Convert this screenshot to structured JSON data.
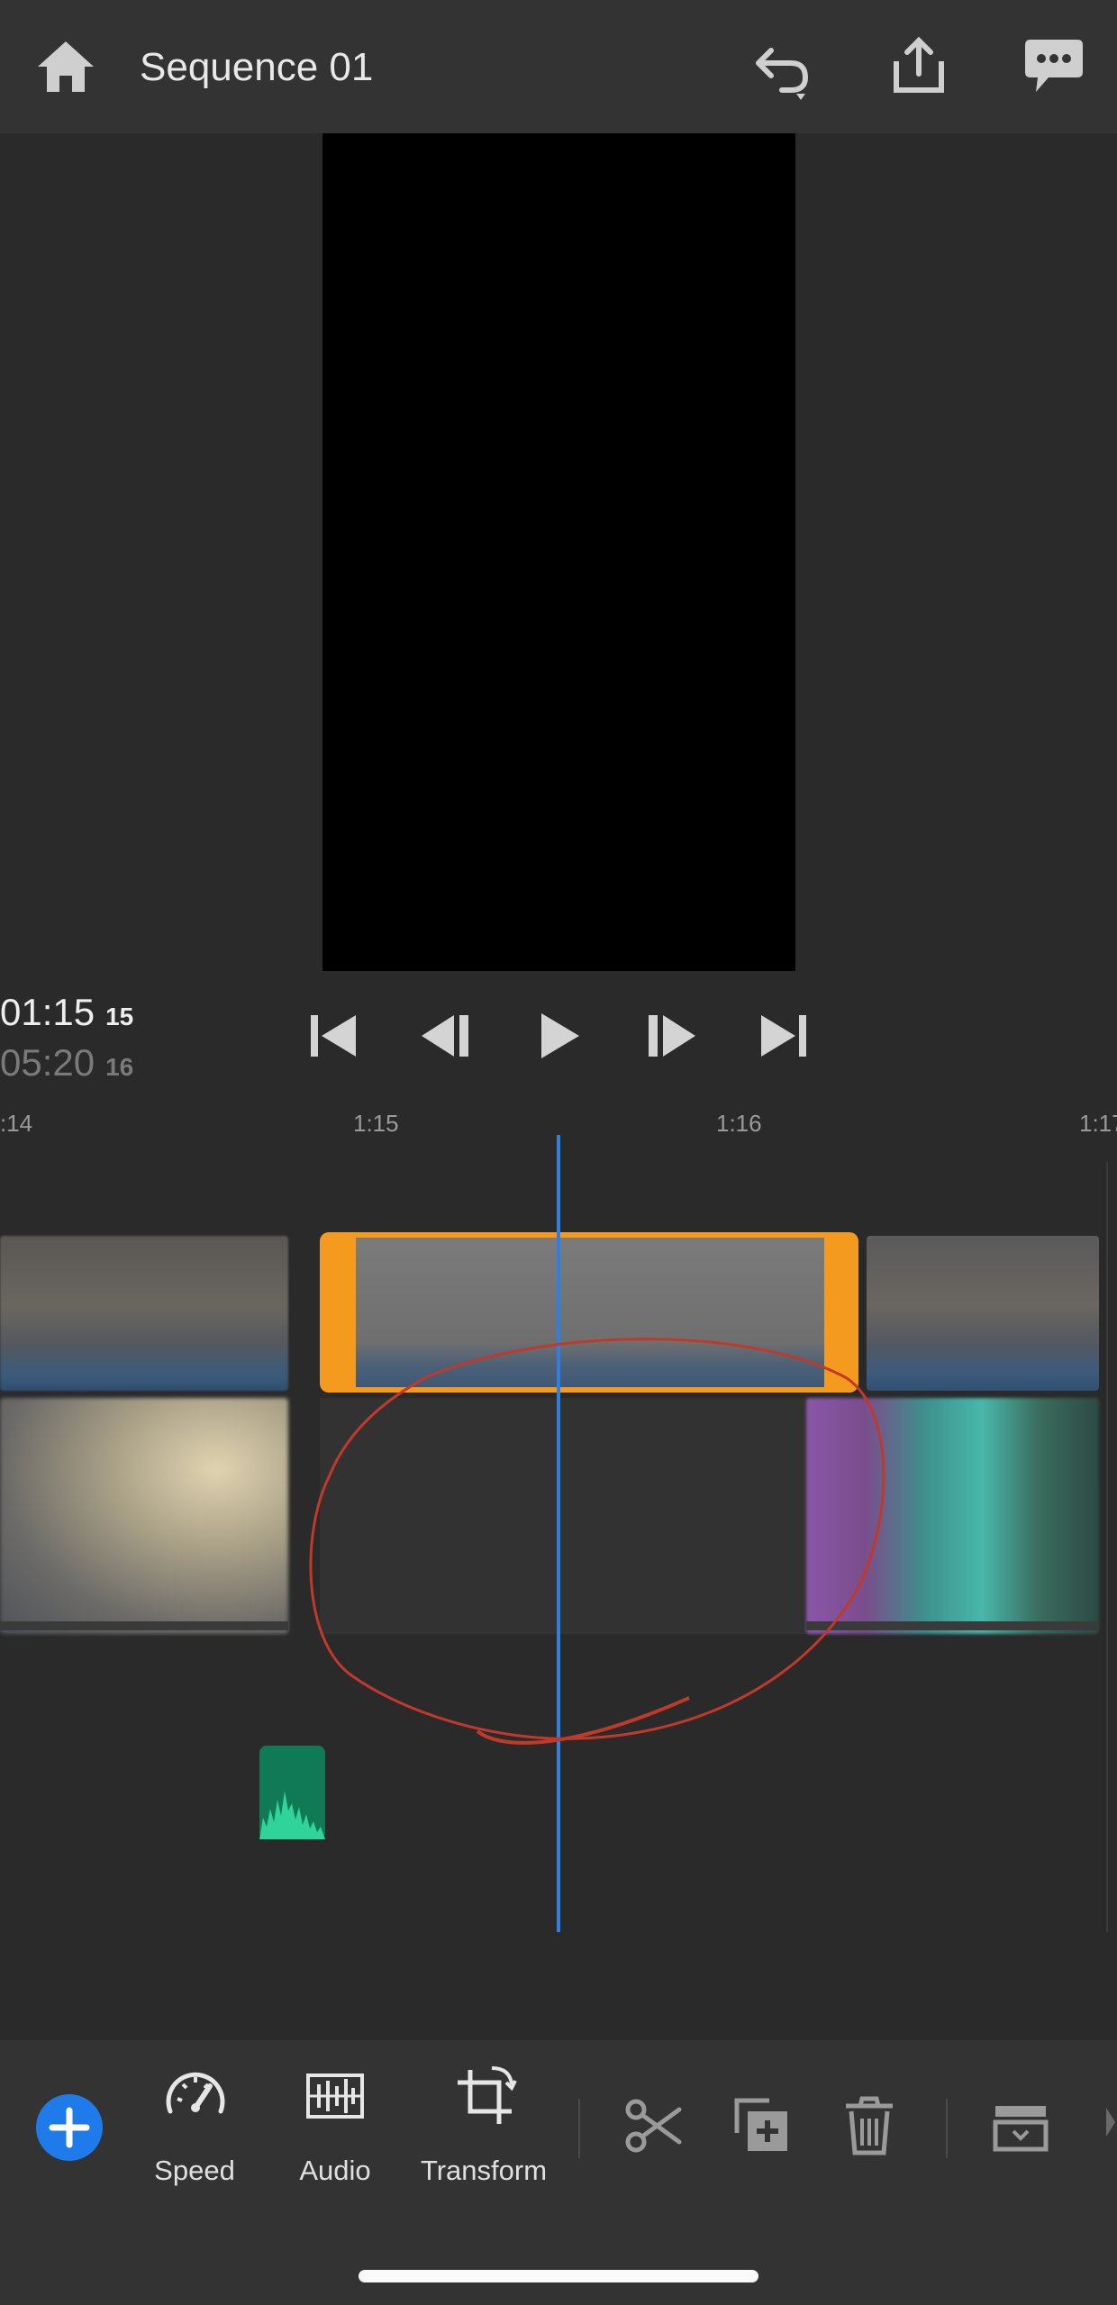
{
  "header": {
    "title": "Sequence 01"
  },
  "timecode": {
    "current": "01:15",
    "current_frames": "15",
    "total": "05:20",
    "total_frames": "16"
  },
  "ruler": {
    "ticks": [
      ":14",
      "1:15",
      "1:16",
      "1:17"
    ]
  },
  "toolbar": {
    "tools": [
      {
        "label": "Speed",
        "icon": "speed-icon"
      },
      {
        "label": "Audio",
        "icon": "audio-icon"
      },
      {
        "label": "Transform",
        "icon": "transform-icon"
      }
    ],
    "actions": [
      "scissors-icon",
      "duplicate-icon",
      "trash-icon",
      "tray-icon"
    ]
  },
  "colors": {
    "accent": "#1f7bea",
    "selection": "#f39a1f",
    "playhead": "#2f7fe0",
    "audio_clip": "#0f7a55",
    "annotation": "#c0392b"
  }
}
